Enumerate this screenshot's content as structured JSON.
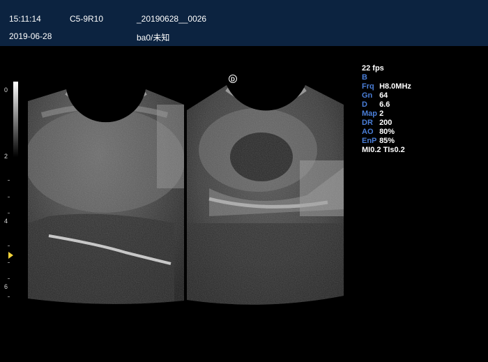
{
  "header": {
    "time": "15:11:14",
    "probe": "C5-9R10",
    "patient_id": "_20190628__0026",
    "date": "2019-06-28",
    "user": "ba0/未知"
  },
  "depth_scale": {
    "labels": [
      "0",
      "2",
      "4",
      "6"
    ]
  },
  "orientation_marker": "D",
  "params": {
    "fps": "22 fps",
    "mode": "B",
    "rows": [
      {
        "key": "Frq",
        "value": "H8.0MHz"
      },
      {
        "key": "Gn",
        "value": "64"
      },
      {
        "key": "D",
        "value": "6.6"
      },
      {
        "key": "Map",
        "value": "2"
      },
      {
        "key": "DR",
        "value": "200"
      },
      {
        "key": "AO",
        "value": "80%"
      },
      {
        "key": "EnP",
        "value": "85%"
      }
    ],
    "mi_ti": "MI0.2  TIs0.2"
  },
  "colors": {
    "header_bg": "#0c2340",
    "param_key": "#4a7ed8",
    "focus_marker": "#f2d33a"
  }
}
